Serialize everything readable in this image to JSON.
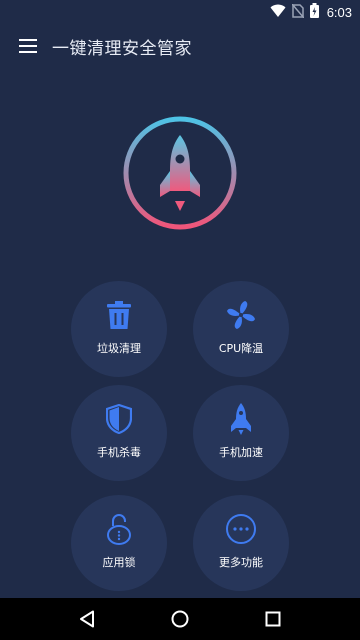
{
  "status_bar": {
    "time": "6:03",
    "icons": [
      "wifi-icon",
      "no-sim-icon",
      "battery-icon"
    ]
  },
  "app_bar": {
    "title": "一键清理安全管家",
    "menu_icon": "menu-icon"
  },
  "boost": {
    "icon": "rocket-icon",
    "ring_gradient": [
      "#4ec3e6",
      "#f0557a"
    ]
  },
  "features": [
    {
      "label": "垃圾清理",
      "icon": "trash-icon"
    },
    {
      "label": "CPU降温",
      "icon": "fan-icon"
    },
    {
      "label": "手机杀毒",
      "icon": "shield-icon"
    },
    {
      "label": "手机加速",
      "icon": "rocket-icon"
    },
    {
      "label": "应用锁",
      "icon": "lock-icon"
    },
    {
      "label": "更多功能",
      "icon": "more-icon"
    }
  ],
  "colors": {
    "background": "#1f2b48",
    "button_bg": "#27365a",
    "accent": "#3f7bf0"
  },
  "nav_bar": {
    "icons": [
      "back-icon",
      "home-icon",
      "recents-icon"
    ]
  }
}
